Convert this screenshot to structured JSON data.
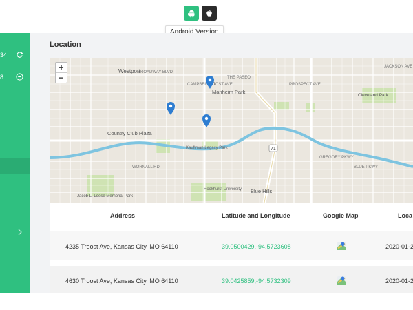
{
  "platform": {
    "android_icon": "android-icon",
    "apple_icon": "apple-icon",
    "tooltip": "Android Version",
    "active_color": "#2fc080"
  },
  "sidebar": {
    "item1_text": "34",
    "item1_icon": "refresh-icon",
    "item2_text": "8",
    "item2_icon": "minus-circle-icon",
    "chevron_icon": "chevron-right-icon"
  },
  "page": {
    "title": "Location"
  },
  "map": {
    "zoom_in": "+",
    "zoom_out": "−",
    "labels": {
      "westport": "Westport",
      "manheim_park": "Manheim Park",
      "country_club_plaza": "Country Club Plaza",
      "kauffman": "Kauffman Legacy Park",
      "rockhurst": "Rockhurst University",
      "blue_hills": "Blue Hills",
      "cleveland_park": "Cleveland Park",
      "loose_park": "Jacob L. Loose Memorial Park",
      "gregory_pkwy": "GREGORY PKWY",
      "blue_pkwy": "BLUE PKWY",
      "hwy71": "71",
      "wornall": "WORNALL RD",
      "troost": "TROOST AVE",
      "prospect": "PROSPECT AVE",
      "jackson": "JACKSON AVE",
      "campbell": "CAMPBELL ST",
      "broadway": "BROADWAY BLVD",
      "paseo": "THE PASEO"
    }
  },
  "table": {
    "headers": {
      "address": "Address",
      "latlng": "Latitude and Longitude",
      "google_map": "Google Map",
      "location_time": "Loca"
    },
    "rows": [
      {
        "address": "4235 Troost Ave, Kansas City, MO 64110",
        "coords": "39.0500429,-94.5723608",
        "map_icon": "google-maps-icon",
        "date": "2020-01-2"
      },
      {
        "address": "4630 Troost Ave, Kansas City, MO 64110",
        "coords": "39.0425859,-94.5732309",
        "map_icon": "google-maps-icon",
        "date": "2020-01-2"
      }
    ]
  }
}
